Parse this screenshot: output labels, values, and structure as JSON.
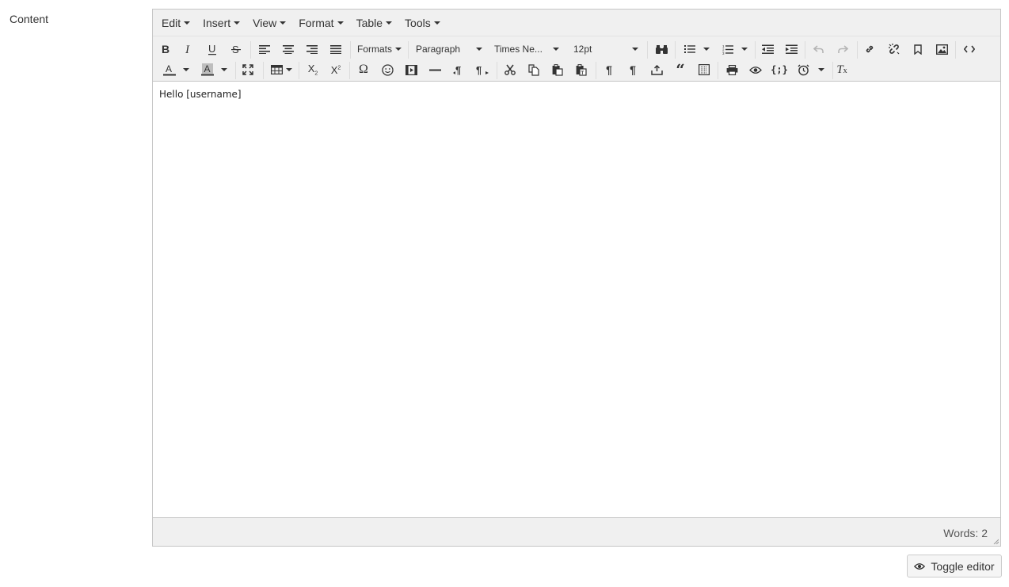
{
  "field": {
    "label": "Content"
  },
  "menubar": {
    "items": [
      {
        "label": "Edit"
      },
      {
        "label": "Insert"
      },
      {
        "label": "View"
      },
      {
        "label": "Format"
      },
      {
        "label": "Table"
      },
      {
        "label": "Tools"
      }
    ]
  },
  "toolbar": {
    "formats_label": "Formats",
    "block_format": "Paragraph",
    "font_family": "Times Ne...",
    "font_size": "12pt",
    "subscript_label": "X",
    "superscript_label": "X",
    "clear_format_label": "T"
  },
  "content": {
    "text": "Hello [username]"
  },
  "status": {
    "words": "Words: 2"
  },
  "toggle": {
    "label": "Toggle editor"
  }
}
